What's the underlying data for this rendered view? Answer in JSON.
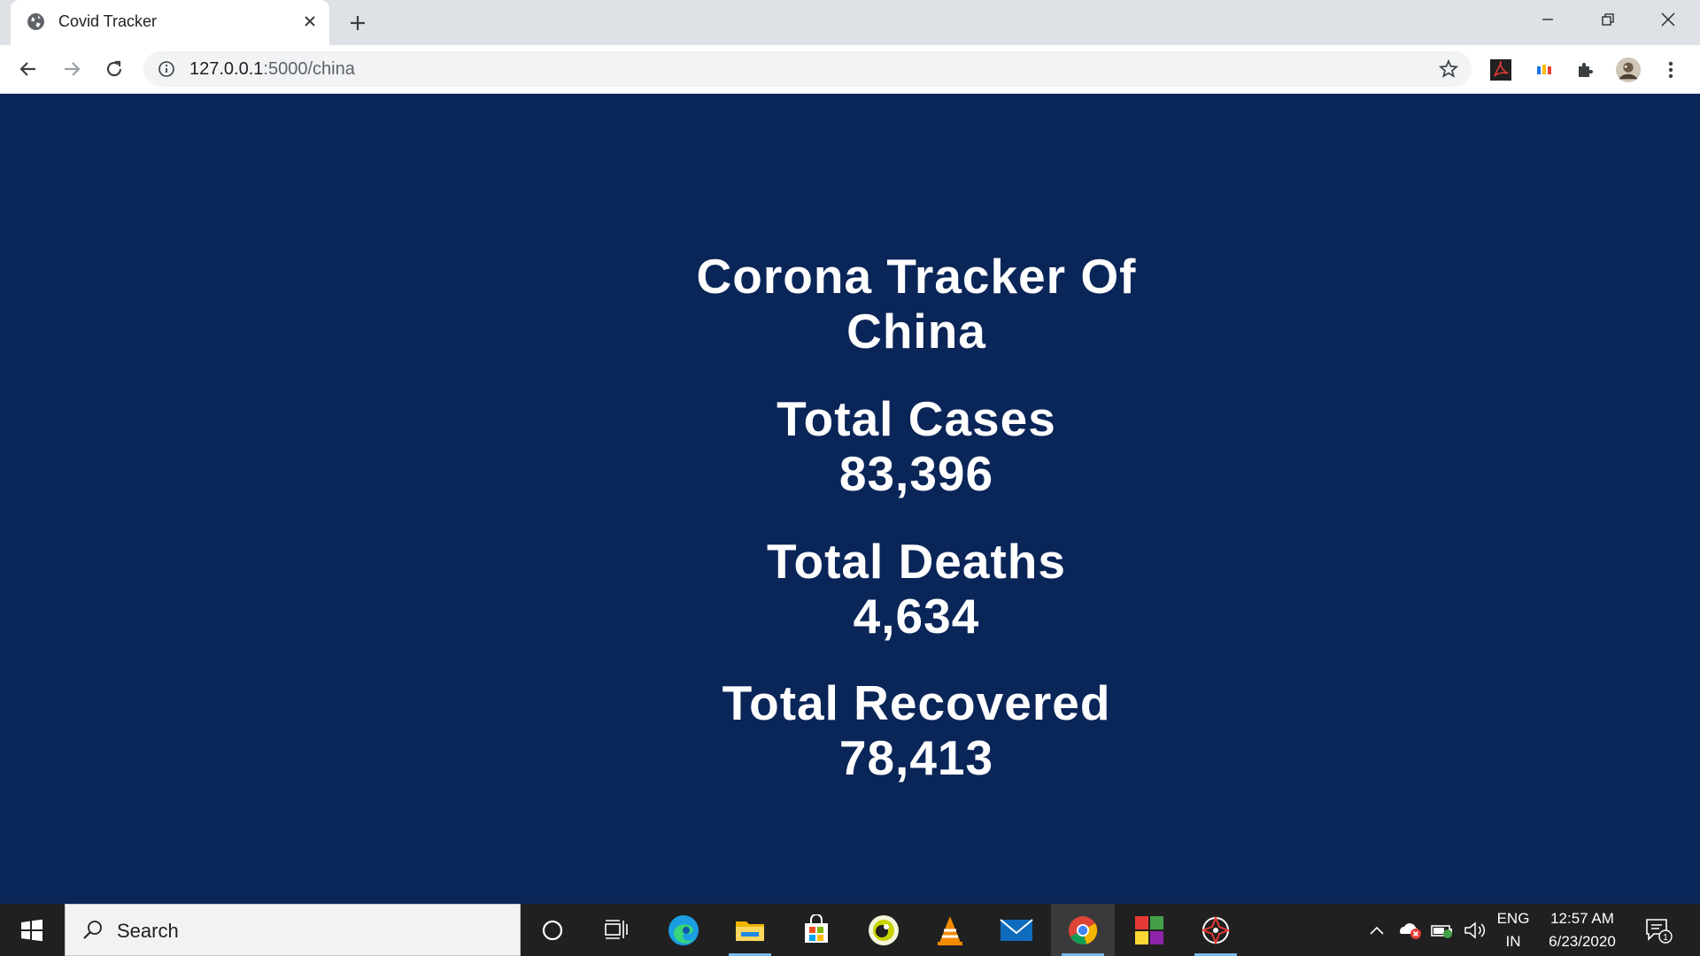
{
  "browser": {
    "tab_title": "Covid Tracker",
    "url_host": "127.0.0.1",
    "url_path": ":5000/china"
  },
  "page": {
    "background": "#0a2558",
    "title_line1": "Corona Tracker Of",
    "title_line2": "China",
    "cases_label": "Total Cases",
    "cases_value": "83,396",
    "deaths_label": "Total Deaths",
    "deaths_value": "4,634",
    "recovered_label": "Total Recovered",
    "recovered_value": "78,413"
  },
  "taskbar": {
    "search_placeholder": "Search",
    "lang_line1": "ENG",
    "lang_line2": "IN",
    "time": "12:57 AM",
    "date": "6/23/2020",
    "notification_count": "1"
  }
}
